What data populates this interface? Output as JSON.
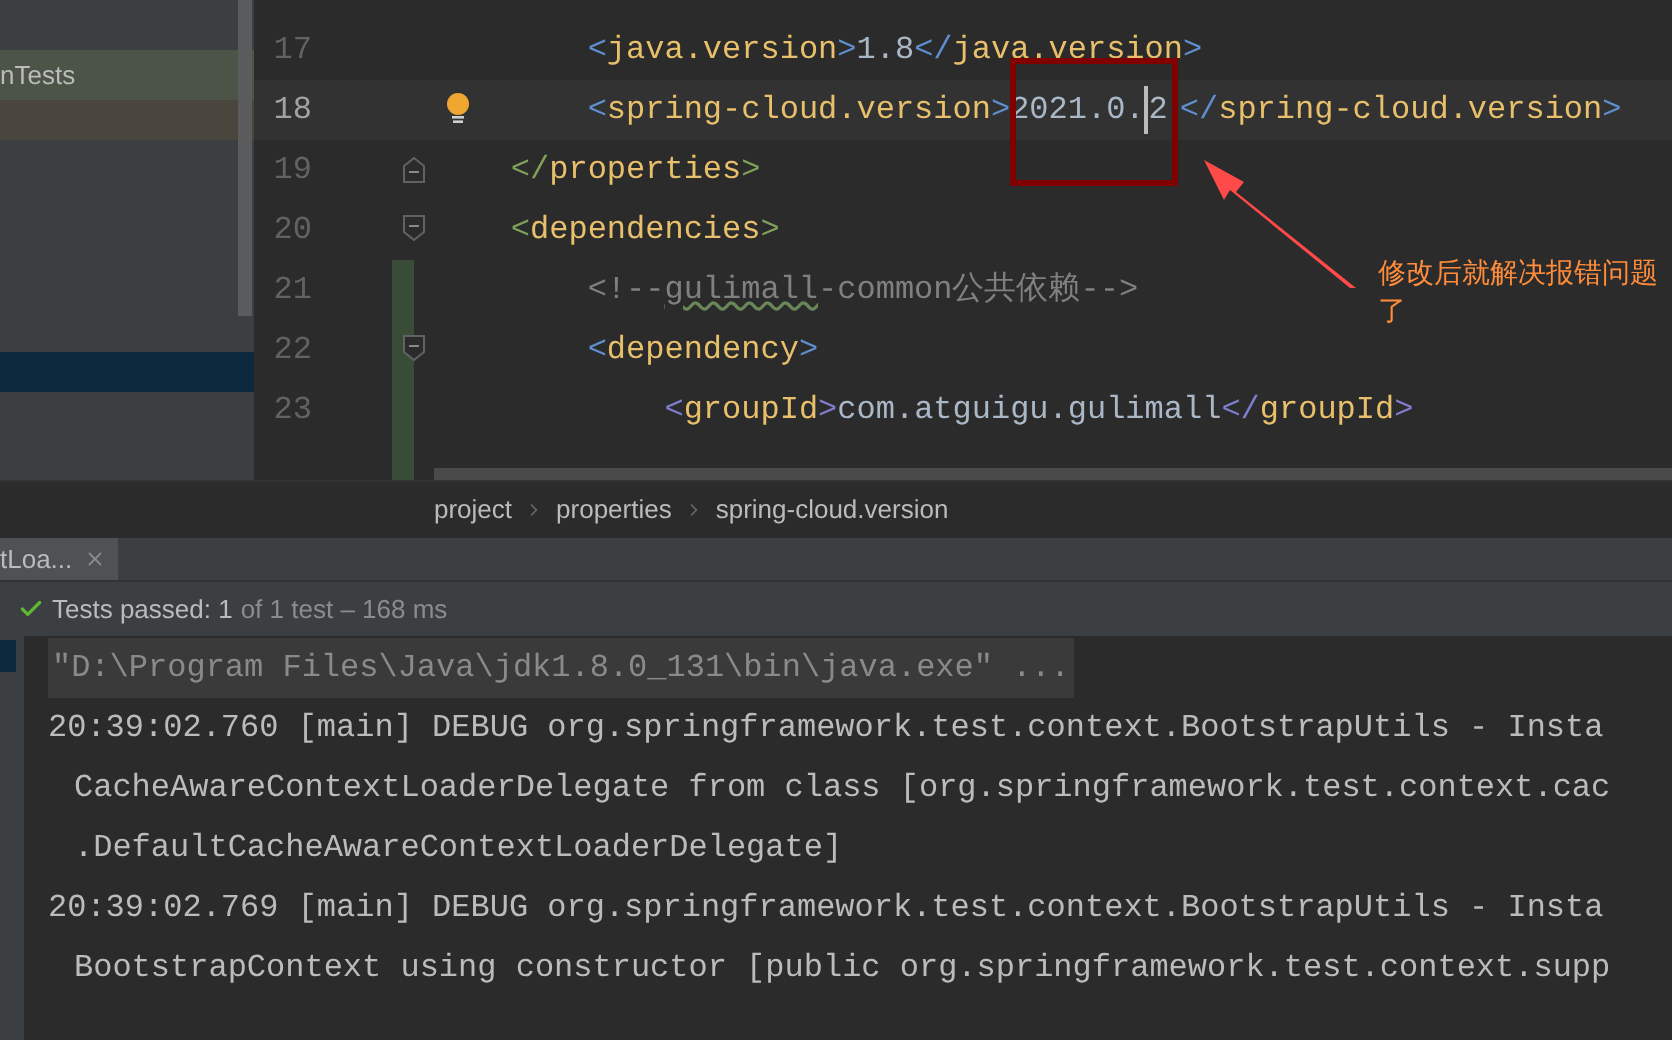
{
  "project_panel": {
    "items": [
      {
        "label": "nTests",
        "selected": false
      }
    ]
  },
  "editor": {
    "lines": [
      {
        "number": "17",
        "current": false,
        "changed": false,
        "fold_start": false,
        "fold_end": false,
        "bulb": false,
        "tokens": [
          {
            "kind": "bracket",
            "color": "#5f8fd0",
            "text": "        <"
          },
          {
            "kind": "tag",
            "text": "java.version"
          },
          {
            "kind": "bracket",
            "color": "#5f8fd0",
            "text": ">"
          },
          {
            "kind": "text",
            "text": "1.8"
          },
          {
            "kind": "bracket",
            "color": "#5f8fd0",
            "text": "</"
          },
          {
            "kind": "tag",
            "text": "java.version"
          },
          {
            "kind": "bracket",
            "color": "#5f8fd0",
            "text": ">"
          }
        ]
      },
      {
        "number": "18",
        "current": true,
        "changed": false,
        "fold_start": false,
        "fold_end": false,
        "bulb": true,
        "tokens": [
          {
            "kind": "bracket",
            "color": "#5f8fd0",
            "text": "        <"
          },
          {
            "kind": "tag",
            "text": "spring-cloud.version"
          },
          {
            "kind": "bracket",
            "color": "#5f8fd0",
            "text": ">"
          },
          {
            "kind": "text",
            "text": "2021.0."
          },
          {
            "kind": "text",
            "text": "2",
            "caret_before": true
          },
          {
            "kind": "bracket",
            "color": "#5f8fd0",
            "text": "</"
          },
          {
            "kind": "tag",
            "text": "spring-cloud.version"
          },
          {
            "kind": "bracket",
            "color": "#5f8fd0",
            "text": ">"
          }
        ]
      },
      {
        "number": "19",
        "current": false,
        "changed": false,
        "fold_start": false,
        "fold_end": true,
        "bulb": false,
        "tokens": [
          {
            "kind": "bracket",
            "color": "#7fa25a",
            "text": "    </"
          },
          {
            "kind": "tag",
            "text": "properties"
          },
          {
            "kind": "bracket",
            "color": "#7fa25a",
            "text": ">"
          }
        ]
      },
      {
        "number": "20",
        "current": false,
        "changed": false,
        "fold_start": true,
        "fold_end": false,
        "bulb": false,
        "tokens": [
          {
            "kind": "bracket",
            "color": "#7fa25a",
            "text": "    <"
          },
          {
            "kind": "tag",
            "text": "dependencies"
          },
          {
            "kind": "bracket",
            "color": "#7fa25a",
            "text": ">"
          }
        ]
      },
      {
        "number": "21",
        "current": false,
        "changed": true,
        "fold_start": false,
        "fold_end": false,
        "bulb": false,
        "tokens": [
          {
            "kind": "comment",
            "text": "        <!--"
          },
          {
            "kind": "typo",
            "text": "gulimall"
          },
          {
            "kind": "comment",
            "text": "-common公共依赖-->"
          }
        ]
      },
      {
        "number": "22",
        "current": false,
        "changed": true,
        "fold_start": true,
        "fold_end": false,
        "bulb": false,
        "tokens": [
          {
            "kind": "bracket",
            "color": "#5f8fd0",
            "text": "        <"
          },
          {
            "kind": "tag",
            "text": "dependency"
          },
          {
            "kind": "bracket",
            "color": "#5f8fd0",
            "text": ">"
          }
        ]
      },
      {
        "number": "23",
        "current": false,
        "changed": true,
        "fold_start": false,
        "fold_end": false,
        "bulb": false,
        "tokens": [
          {
            "kind": "bracket",
            "color": "#7f7fd0",
            "text": "            <"
          },
          {
            "kind": "tag",
            "text": "groupId"
          },
          {
            "kind": "bracket",
            "color": "#7f7fd0",
            "text": ">"
          },
          {
            "kind": "text",
            "text": "com.atguigu.gulimall"
          },
          {
            "kind": "bracket",
            "color": "#7f7fd0",
            "text": "</"
          },
          {
            "kind": "tag",
            "text": "groupId"
          },
          {
            "kind": "bracket",
            "color": "#7f7fd0",
            "text": ">"
          }
        ]
      }
    ],
    "annotation": {
      "text": "修改后就解决报错问题了"
    },
    "breadcrumb": [
      "project",
      "properties",
      "spring-cloud.version"
    ]
  },
  "run_panel": {
    "tab": {
      "label": "tLoa..."
    },
    "status": {
      "passed": true,
      "label": "Tests passed: 1",
      "detail": "of 1 test – 168 ms"
    },
    "console": [
      {
        "kind": "command",
        "text": "\"D:\\Program Files\\Java\\jdk1.8.0_131\\bin\\java.exe\" ..."
      },
      {
        "kind": "log",
        "text": "20:39:02.760 [main] DEBUG org.springframework.test.context.BootstrapUtils - Insta"
      },
      {
        "kind": "cont",
        "text": "CacheAwareContextLoaderDelegate from class [org.springframework.test.context.cac"
      },
      {
        "kind": "cont",
        "text": ".DefaultCacheAwareContextLoaderDelegate]"
      },
      {
        "kind": "log",
        "text": "20:39:02.769 [main] DEBUG org.springframework.test.context.BootstrapUtils - Insta"
      },
      {
        "kind": "cont",
        "text": "BootstrapContext using constructor [public org.springframework.test.context.supp"
      }
    ]
  }
}
